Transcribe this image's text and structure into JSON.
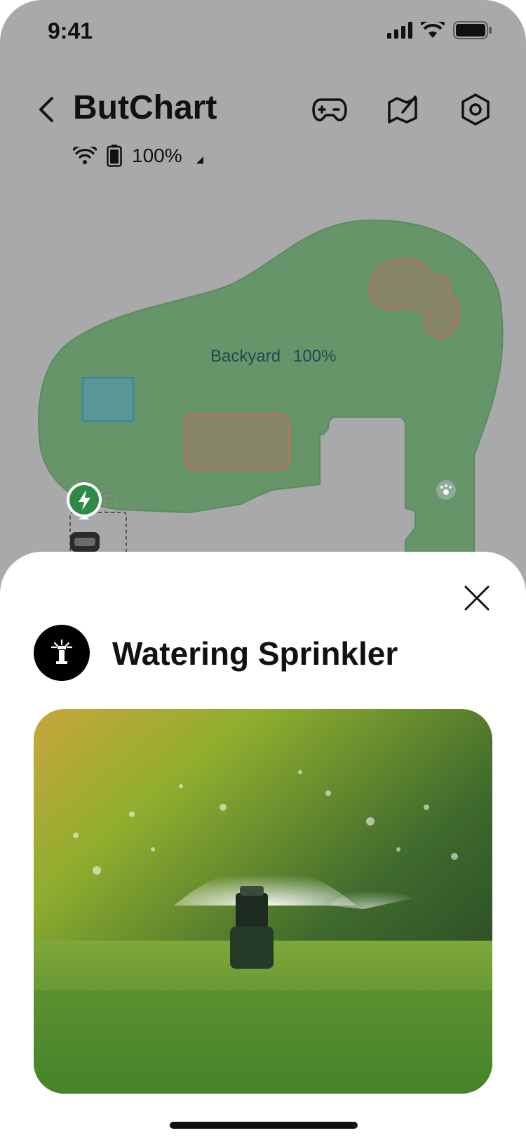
{
  "status_bar": {
    "time": "9:41",
    "icons": [
      "signal-icon",
      "wifi-icon",
      "battery-icon"
    ]
  },
  "header": {
    "title": "ButChart",
    "back_icon": "chevron-left-icon",
    "actions": [
      "gamepad-icon",
      "map-edit-icon",
      "settings-icon"
    ]
  },
  "device_status": {
    "wifi_icon": "wifi-icon",
    "battery_icon": "battery-icon",
    "battery_percent": "100%",
    "caret_icon": "caret-icon"
  },
  "map": {
    "zone_name": "Backyard",
    "zone_progress": "100%",
    "colors": {
      "lawn": "#66956a",
      "lawn_border": "#5c8a61",
      "no_go": "#85866a",
      "no_go_border": "#c96c5c",
      "channel": "#5b9696",
      "channel_border": "#3f7fa6",
      "charger": "#2e8b46"
    },
    "markers": [
      "charging-station-icon",
      "robot-mower-icon",
      "pet-paw-icon"
    ]
  },
  "sheet": {
    "icon": "sprinkler-icon",
    "title": "Watering Sprinkler",
    "close_icon": "close-icon",
    "image_subject": "sprinkler-photo"
  }
}
